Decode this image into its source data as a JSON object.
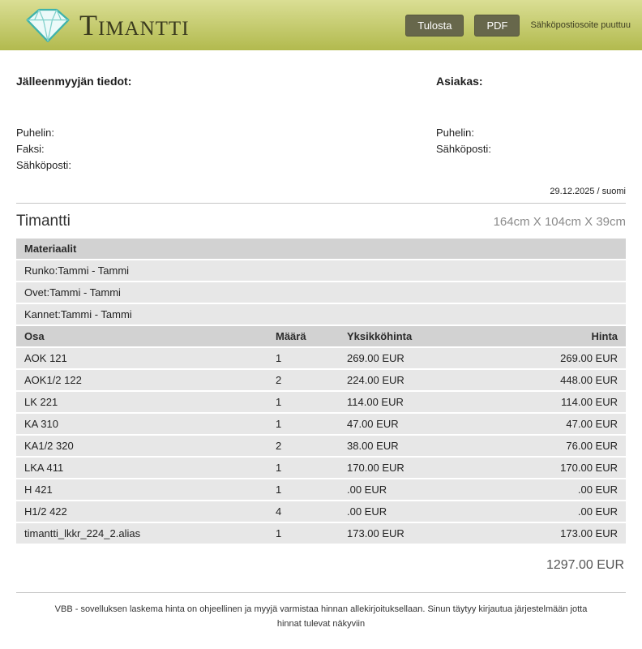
{
  "header": {
    "brand": "Timantti",
    "print_label": "Tulosta",
    "pdf_label": "PDF",
    "notice": "Sähköpostiosoite puuttuu",
    "colors": {
      "header_top": "#dade94",
      "header_bottom": "#b2ba4e",
      "button": "#67674b",
      "diamond": "#3fb3ab"
    }
  },
  "info": {
    "reseller_title": "Jälleenmyyjän tiedot:",
    "customer_title": "Asiakas:",
    "reseller_fields": [
      "Puhelin:",
      "Faksi:",
      "Sähköposti:"
    ],
    "customer_fields": [
      "Puhelin:",
      "Sähköposti:"
    ],
    "date_locale": "29.12.2025 / suomi"
  },
  "product": {
    "name": "Timantti",
    "dimensions": "164cm X 104cm X 39cm"
  },
  "materials": {
    "title": "Materiaalit",
    "rows": [
      "Runko:Tammi - Tammi",
      "Ovet:Tammi - Tammi",
      "Kannet:Tammi - Tammi"
    ]
  },
  "parts": {
    "headers": [
      "Osa",
      "Määrä",
      "Yksikköhinta",
      "Hinta"
    ],
    "rows": [
      {
        "part": "AOK 121",
        "qty": "1",
        "unit": "269.00 EUR",
        "price": "269.00 EUR"
      },
      {
        "part": "AOK1/2 122",
        "qty": "2",
        "unit": "224.00 EUR",
        "price": "448.00 EUR"
      },
      {
        "part": "LK 221",
        "qty": "1",
        "unit": "114.00 EUR",
        "price": "114.00 EUR"
      },
      {
        "part": "KA 310",
        "qty": "1",
        "unit": "47.00 EUR",
        "price": "47.00 EUR"
      },
      {
        "part": "KA1/2 320",
        "qty": "2",
        "unit": "38.00 EUR",
        "price": "76.00 EUR"
      },
      {
        "part": "LKA 411",
        "qty": "1",
        "unit": "170.00 EUR",
        "price": "170.00 EUR"
      },
      {
        "part": "H 421",
        "qty": "1",
        "unit": ".00 EUR",
        "price": ".00 EUR"
      },
      {
        "part": "H1/2 422",
        "qty": "4",
        "unit": ".00 EUR",
        "price": ".00 EUR"
      },
      {
        "part": "timantti_lkkr_224_2.alias",
        "qty": "1",
        "unit": "173.00 EUR",
        "price": "173.00 EUR"
      }
    ]
  },
  "totals": {
    "total": "1297.00 EUR"
  },
  "footer": {
    "disclaimer": "VBB - sovelluksen laskema hinta on ohjeellinen ja myyjä varmistaa hinnan allekirjoituksellaan. Sinun täytyy kirjautua järjestelmään jotta hinnat tulevat näkyviin"
  }
}
